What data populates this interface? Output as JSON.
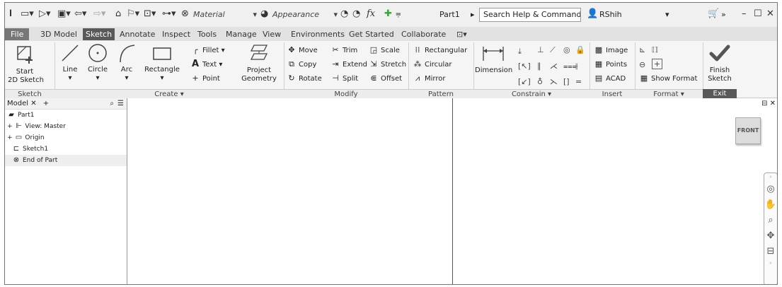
{
  "qab": {
    "material_placeholder": "Material",
    "appearance_placeholder": "Appearance",
    "fx_label": "fx",
    "document_title": "Part1",
    "search_placeholder": "Search Help & Commands...",
    "user_name": "RShih"
  },
  "tabs": [
    "File",
    "3D Model",
    "Sketch",
    "Annotate",
    "Inspect",
    "Tools",
    "Manage",
    "View",
    "Environments",
    "Get Started",
    "Collaborate"
  ],
  "active_tab": "Sketch",
  "ribbon": {
    "sketch_panel": {
      "title": "Sketch",
      "start_label": "Start\n2D Sketch"
    },
    "create_panel": {
      "title": "Create ▾",
      "line": "Line",
      "circle": "Circle",
      "arc": "Arc",
      "rectangle": "Rectangle",
      "fillet": "Fillet",
      "text": "Text",
      "point": "Point",
      "project_geometry": "Project\nGeometry"
    },
    "modify_panel": {
      "title": "Modify",
      "move": "Move",
      "trim": "Trim",
      "scale": "Scale",
      "copy": "Copy",
      "extend": "Extend",
      "stretch": "Stretch",
      "rotate": "Rotate",
      "split": "Split",
      "offset": "Offset"
    },
    "pattern_panel": {
      "title": "Pattern",
      "rectangular": "Rectangular",
      "circular": "Circular",
      "mirror": "Mirror"
    },
    "constrain_panel": {
      "title": "Constrain ▾",
      "dimension": "Dimension"
    },
    "insert_panel": {
      "title": "Insert",
      "image": "Image",
      "points": "Points",
      "acad": "ACAD"
    },
    "format_panel": {
      "title": "Format ▾",
      "show_format": "Show Format"
    },
    "exit_panel": {
      "title": "Exit",
      "finish_sketch": "Finish\nSketch"
    }
  },
  "browser": {
    "tab_label": "Model",
    "items": [
      "Part1",
      "View: Master",
      "Origin",
      "Sketch1",
      "End of Part"
    ]
  },
  "viewcube": {
    "face": "FRONT"
  },
  "colors": {
    "active_tab_bg": "#595959",
    "file_tab_bg": "#777777",
    "finish_check": "#555555"
  }
}
